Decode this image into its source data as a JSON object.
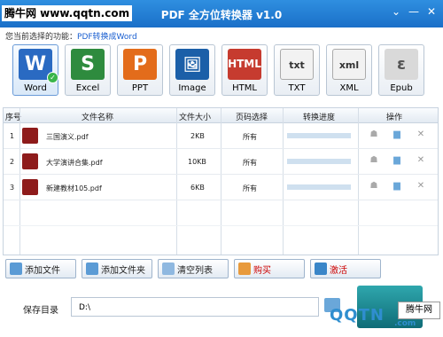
{
  "watermark_top": "腾牛网 www.qqtn.com",
  "window": {
    "title": "PDF 全方位转换器 v1.0",
    "controls": [
      "⌄",
      "—",
      "✕"
    ]
  },
  "function_row": {
    "label": "您当前选择的功能：",
    "value": "PDF转换成Word"
  },
  "formats": [
    {
      "label": "Word",
      "glyph": "W",
      "color": "#2a6ac2",
      "selected": true
    },
    {
      "label": "Excel",
      "glyph": "S",
      "color": "#2e8b3e"
    },
    {
      "label": "PPT",
      "glyph": "P",
      "color": "#e36c1b"
    },
    {
      "label": "Image",
      "glyph": "🖼",
      "color": "#1b5fa8"
    },
    {
      "label": "HTML",
      "glyph": "HTML",
      "color": "#c63b2f"
    },
    {
      "label": "TXT",
      "glyph": "txt",
      "color": "#f2f2f2"
    },
    {
      "label": "XML",
      "glyph": "xml",
      "color": "#f2f2f2"
    },
    {
      "label": "Epub",
      "glyph": "ε",
      "color": "#d9d9d9"
    }
  ],
  "table": {
    "headers": {
      "index": "序号",
      "name": "文件名称",
      "size": "文件大小",
      "pages": "页码选择",
      "progress": "转换进度",
      "action": "操作"
    },
    "rows": [
      {
        "index": "1",
        "name": "三国演义.pdf",
        "size": "2KB",
        "pages": "所有",
        "progress": 0
      },
      {
        "index": "2",
        "name": "大学演讲合集.pdf",
        "size": "10KB",
        "pages": "所有",
        "progress": 0
      },
      {
        "index": "3",
        "name": "新建教材105.pdf",
        "size": "6KB",
        "pages": "所有",
        "progress": 0
      }
    ]
  },
  "buttons": {
    "add_file": "添加文件",
    "add_folder": "添加文件夹",
    "clear_list": "清空列表",
    "buy": "购买",
    "activate": "激活"
  },
  "save": {
    "label": "保存目录",
    "value": "D:\\"
  },
  "watermark_bottom": {
    "text": "QQTN",
    "badge": "腾牛网",
    "suffix": ".com"
  }
}
